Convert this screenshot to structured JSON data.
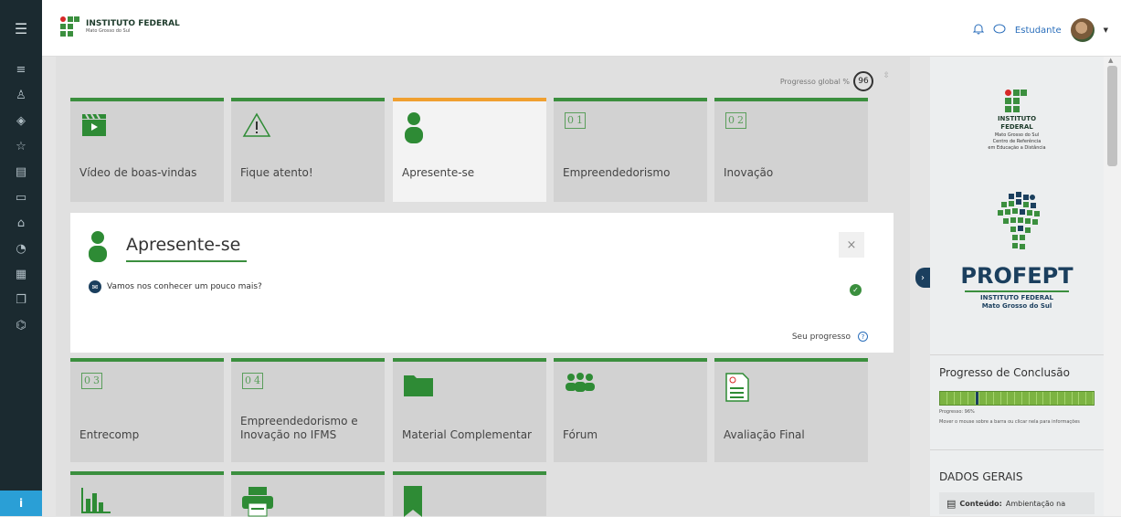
{
  "topbar": {
    "brand_line1": "INSTITUTO FEDERAL",
    "brand_line2": "Mato Grosso do Sul",
    "user_name": "Estudante",
    "icons": [
      "bell-icon",
      "chat-icon",
      "caret-down-icon"
    ]
  },
  "sidebar": {
    "icons": [
      "menu-icon",
      "list-icon",
      "users-icon",
      "layers-icon",
      "star-icon",
      "book-icon",
      "folder-icon",
      "home-icon",
      "dashboard-icon",
      "calendar-icon",
      "files-icon",
      "graduation-icon",
      "info-icon"
    ]
  },
  "course": {
    "progress_label": "Progresso global %",
    "progress_value": "96",
    "tiles_row1": [
      {
        "label": "Vídeo de boas-vindas",
        "icon": "clapperboard-icon"
      },
      {
        "label": "Fique atento!",
        "icon": "warning-icon"
      },
      {
        "label": "Apresente-se",
        "icon": "person-icon"
      },
      {
        "label": "Empreendedorismo",
        "icon": "book-01-icon",
        "num": "01"
      },
      {
        "label": "Inovação",
        "icon": "book-02-icon",
        "num": "02"
      }
    ],
    "tiles_row2": [
      {
        "label": "Entrecomp",
        "icon": "book-03-icon",
        "num": "03"
      },
      {
        "label": "Empreendedorismo e Inovação no IFMS",
        "icon": "book-04-icon",
        "num": "04"
      },
      {
        "label": "Material Complementar",
        "icon": "folder-icon"
      },
      {
        "label": "Fórum",
        "icon": "group-icon"
      },
      {
        "label": "Avaliação Final",
        "icon": "document-icon"
      }
    ],
    "tiles_row3": [
      {
        "label": "",
        "icon": "bar-chart-icon"
      },
      {
        "label": "",
        "icon": "printer-icon"
      },
      {
        "label": "",
        "icon": "bookmark-icon"
      }
    ]
  },
  "panel": {
    "title": "Apresente-se",
    "activity": "Vamos nos conhecer um pouco mais?",
    "progress_label": "Seu progresso",
    "close_glyph": "×"
  },
  "right": {
    "if_line1": "INSTITUTO",
    "if_line2": "FEDERAL",
    "if_line3": "Mato Grosso do Sul",
    "if_line4": "Centro de Referência",
    "if_line5": "em Educação a Distância",
    "profept": "PROFEPT",
    "profept_sub1": "INSTITUTO FEDERAL",
    "profept_sub2": "Mato Grosso do Sul",
    "completion_title": "Progresso de Conclusão",
    "completion_progress": "Progresso: 96%",
    "completion_hint": "Mover o mouse sobre a barra ou clicar nela para informações",
    "dados_title": "DADOS GERAIS",
    "conteudo_label": "Conteúdo:",
    "conteudo_value": "Ambientação na"
  },
  "colors": {
    "accent": "#3b8f3e",
    "active": "#f0a030",
    "navy": "#1b3f5e",
    "sidebar": "#1b2a30"
  }
}
